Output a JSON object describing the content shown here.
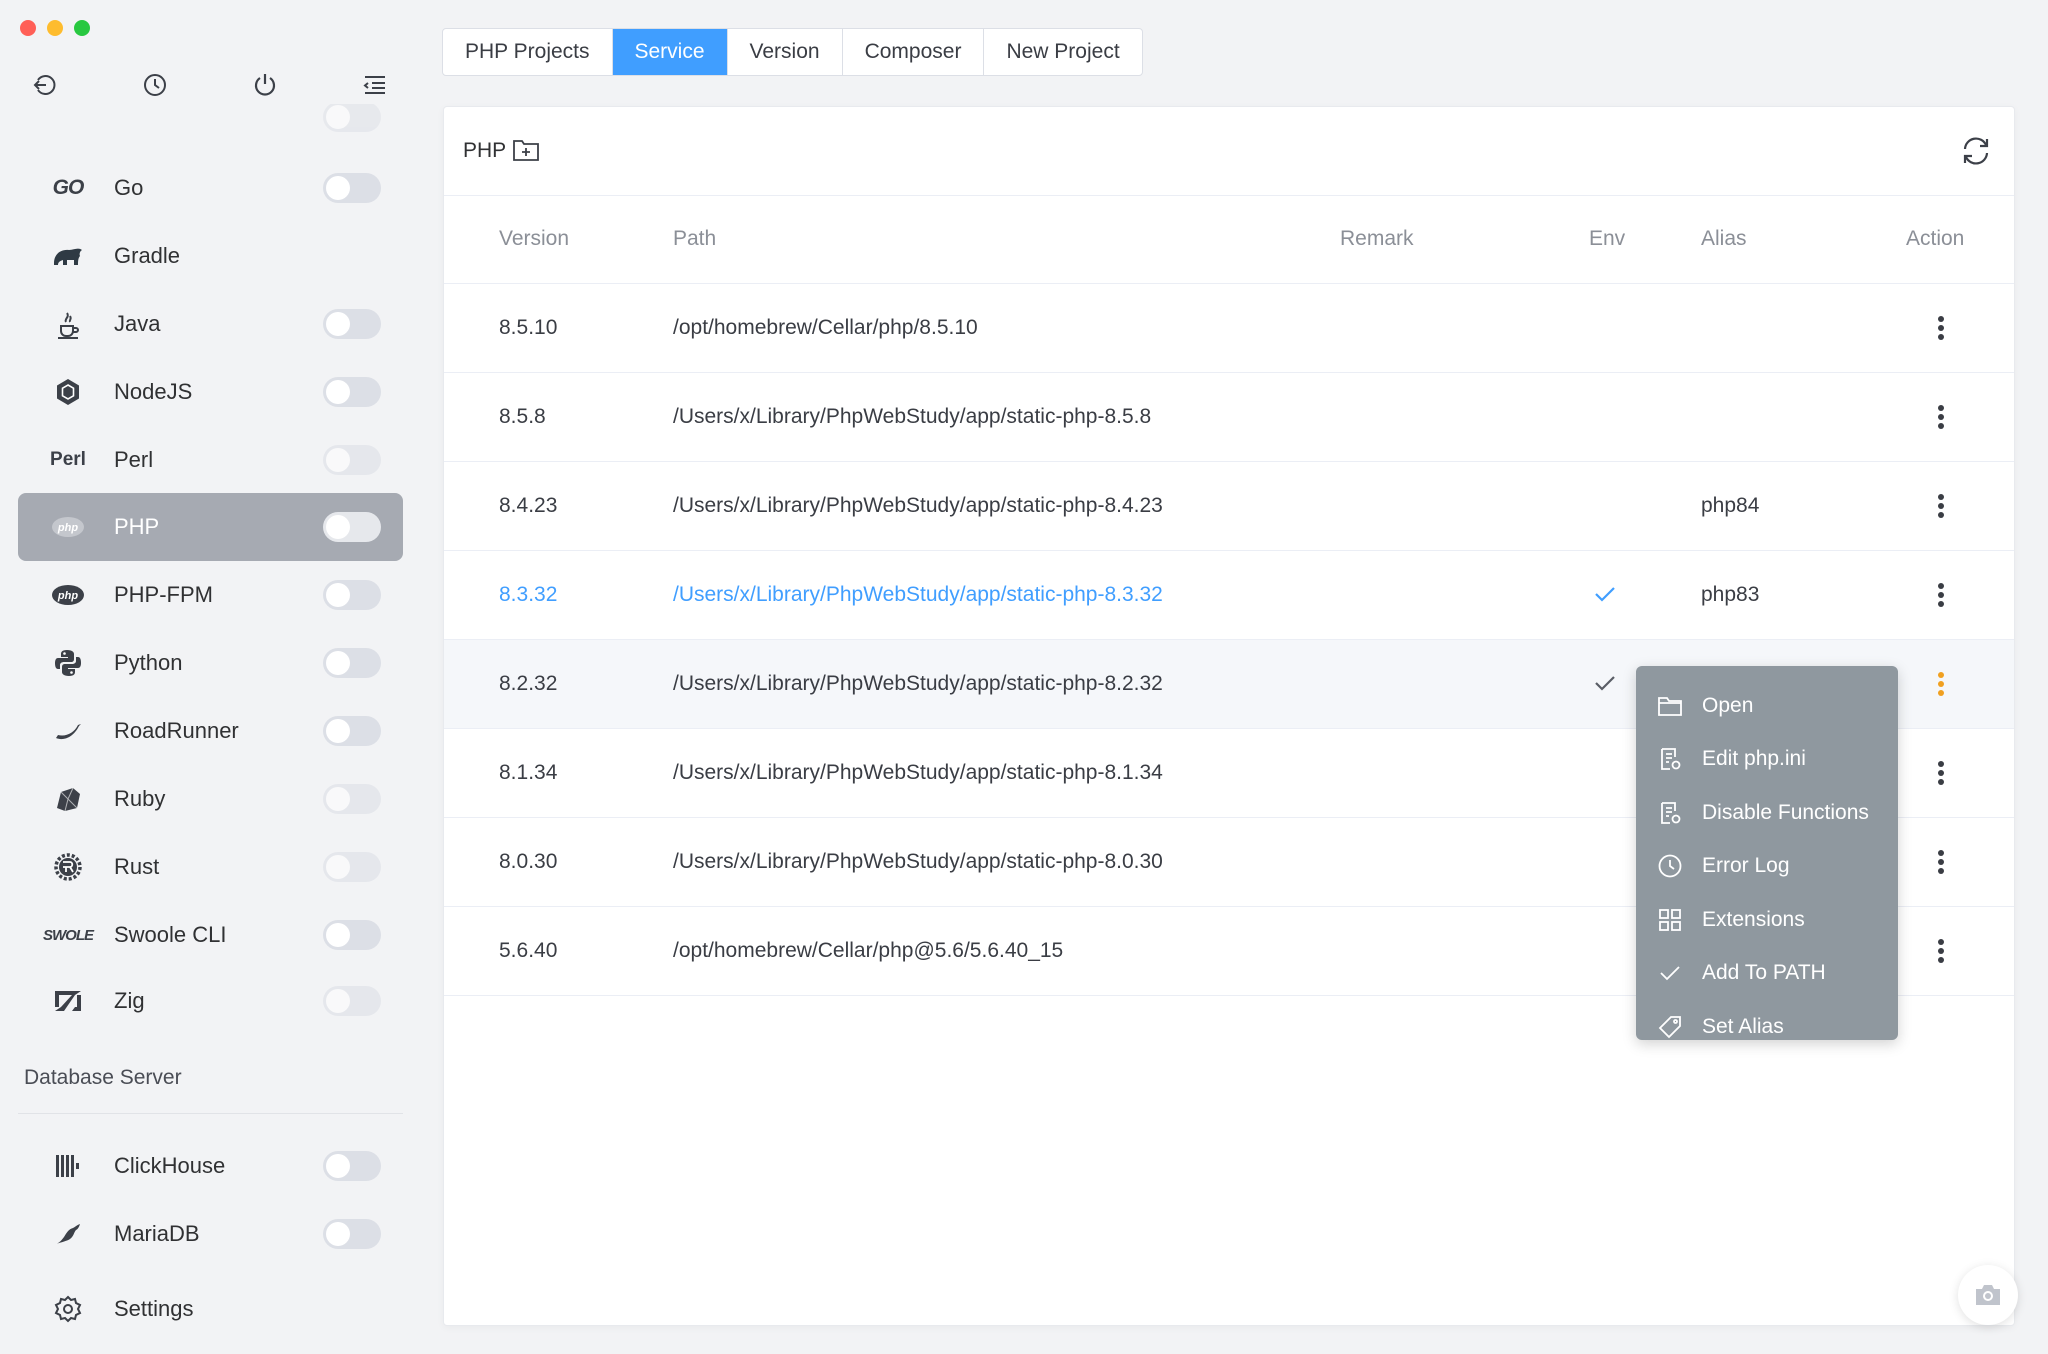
{
  "window": {
    "colors": {
      "close": "#ff5f57",
      "minimize": "#febc2e",
      "zoom": "#28c840"
    }
  },
  "toolbar": {
    "icons": [
      "back-icon",
      "history-icon",
      "power-icon",
      "menu-collapse-icon"
    ]
  },
  "sidebar": {
    "items": [
      {
        "label": "Go",
        "icon": "GO",
        "toggle_on": false
      },
      {
        "label": "Gradle",
        "icon": "gradle-elephant",
        "toggle_on": false,
        "no_toggle": true
      },
      {
        "label": "Java",
        "icon": "java-cup",
        "toggle_on": false
      },
      {
        "label": "NodeJS",
        "icon": "nodejs-hex",
        "toggle_on": false
      },
      {
        "label": "Perl",
        "icon": "Perl",
        "toggle_on": false
      },
      {
        "label": "PHP",
        "icon": "php",
        "toggle_on": false,
        "active": true
      },
      {
        "label": "PHP-FPM",
        "icon": "php",
        "toggle_on": false
      },
      {
        "label": "Python",
        "icon": "python",
        "toggle_on": false
      },
      {
        "label": "RoadRunner",
        "icon": "roadrunner",
        "toggle_on": false
      },
      {
        "label": "Ruby",
        "icon": "ruby",
        "toggle_on": false
      },
      {
        "label": "Rust",
        "icon": "rust",
        "toggle_on": false
      },
      {
        "label": "Swoole CLI",
        "icon": "SWOOLE",
        "toggle_on": false
      },
      {
        "label": "Zig",
        "icon": "zig",
        "toggle_on": false
      }
    ],
    "section_title": "Database Server",
    "db_items": [
      {
        "label": "ClickHouse",
        "icon": "clickhouse-bars"
      },
      {
        "label": "MariaDB",
        "icon": "mariadb-seal"
      }
    ],
    "settings_label": "Settings",
    "icon_text": {
      "go": "GO",
      "perl": "Perl",
      "php": "php",
      "swoole": "SWOLE"
    }
  },
  "tabs": [
    "PHP Projects",
    "Service",
    "Version",
    "Composer",
    "New Project"
  ],
  "active_tab": "Service",
  "panel": {
    "title": "PHP"
  },
  "table": {
    "columns": {
      "version": "Version",
      "path": "Path",
      "remark": "Remark",
      "env": "Env",
      "alias": "Alias",
      "action": "Action"
    },
    "rows": [
      {
        "version": "8.5.10",
        "path": "/opt/homebrew/Cellar/php/8.5.10",
        "remark": "",
        "env": false,
        "alias": ""
      },
      {
        "version": "8.5.8",
        "path": "/Users/x/Library/PhpWebStudy/app/static-php-8.5.8",
        "remark": "",
        "env": false,
        "alias": ""
      },
      {
        "version": "8.4.23",
        "path": "/Users/x/Library/PhpWebStudy/app/static-php-8.4.23",
        "remark": "",
        "env": false,
        "alias": "php84"
      },
      {
        "version": "8.3.32",
        "path": "/Users/x/Library/PhpWebStudy/app/static-php-8.3.32",
        "remark": "",
        "env": true,
        "alias": "php83",
        "highlight": true
      },
      {
        "version": "8.2.32",
        "path": "/Users/x/Library/PhpWebStudy/app/static-php-8.2.32",
        "remark": "",
        "env": true,
        "alias": "",
        "hover": true
      },
      {
        "version": "8.1.34",
        "path": "/Users/x/Library/PhpWebStudy/app/static-php-8.1.34",
        "remark": "",
        "env": false,
        "alias": ""
      },
      {
        "version": "8.0.30",
        "path": "/Users/x/Library/PhpWebStudy/app/static-php-8.0.30",
        "remark": "",
        "env": false,
        "alias": ""
      },
      {
        "version": "5.6.40",
        "path": "/opt/homebrew/Cellar/php@5.6/5.6.40_15",
        "remark": "",
        "env": false,
        "alias": ""
      }
    ]
  },
  "context_menu": {
    "items": [
      {
        "label": "Open",
        "icon": "folder-icon"
      },
      {
        "label": "Edit php.ini",
        "icon": "file-edit-icon"
      },
      {
        "label": "Disable Functions",
        "icon": "file-edit-icon"
      },
      {
        "label": "Error Log",
        "icon": "clock-icon"
      },
      {
        "label": "Extensions",
        "icon": "grid-icon"
      },
      {
        "label": "Add To PATH",
        "icon": "check-icon"
      },
      {
        "label": "Set Alias",
        "icon": "tag-icon"
      }
    ]
  },
  "colors": {
    "accent": "#409eff",
    "menu_bg": "#8f989f",
    "active_nav": "#a6aab2",
    "action_highlight": "#f0a020"
  }
}
